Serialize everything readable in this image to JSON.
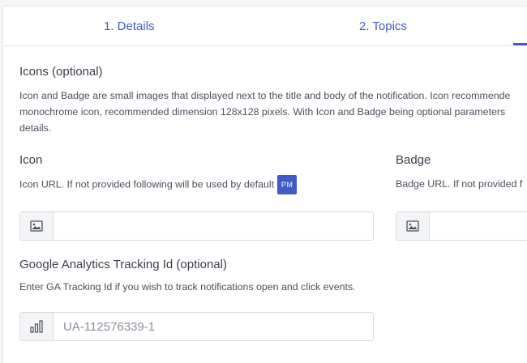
{
  "tabs": [
    {
      "label": "1. Details"
    },
    {
      "label": "2. Topics"
    }
  ],
  "icons_section": {
    "title": "Icons (optional)",
    "description_lines": [
      "Icon and Badge are small images that displayed next to the title and body of the notification. Icon recommende",
      "monochrome icon, recommended dimension 128x128 pixels. With Icon and Badge being optional parameters",
      "details."
    ]
  },
  "icon_field": {
    "label": "Icon",
    "help": "Icon URL. If not provided following will be used by default",
    "default_badge": "PM",
    "value": "",
    "addon_icon": "image-icon"
  },
  "badge_field": {
    "label": "Badge",
    "help": "Badge URL. If not provided f",
    "value": "",
    "addon_icon": "image-icon"
  },
  "ga_field": {
    "label": "Google Analytics Tracking Id (optional)",
    "help": "Enter GA Tracking Id if you wish to track notifications open and click events.",
    "placeholder": "UA-112576339-1",
    "addon_icon": "bar-chart-icon"
  },
  "colors": {
    "accent": "#3f5bc7"
  }
}
